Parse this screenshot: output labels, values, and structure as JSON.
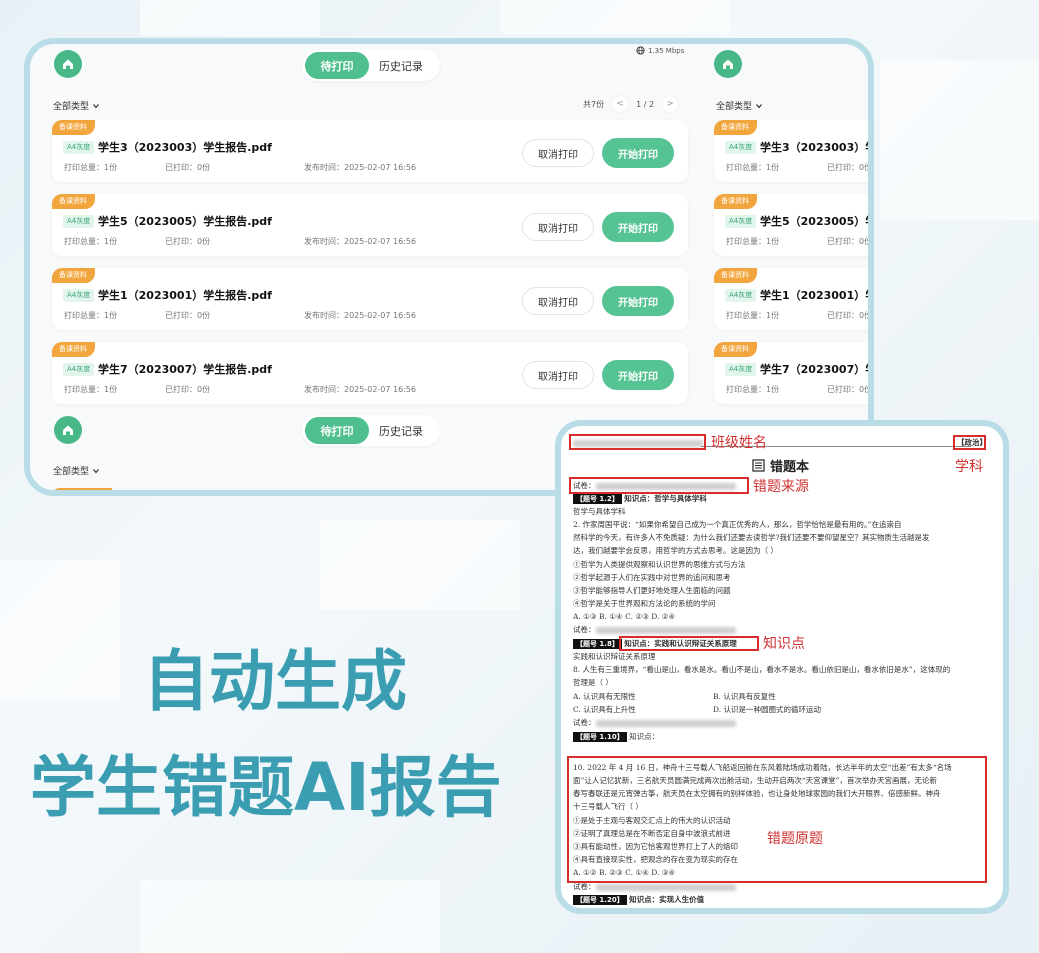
{
  "app": {
    "tabs": [
      {
        "label": "待打印",
        "active": true
      },
      {
        "label": "历史记录",
        "active": false
      }
    ],
    "network_speed": "1.35 Mbps",
    "filter_label": "全部类型",
    "pager": {
      "total": "共7份",
      "page": "1 / 2",
      "prev": "<",
      "next": ">"
    },
    "cards": [
      {
        "tag": "备课资料",
        "paper": "A4灰度",
        "file": "学生3（2023003）学生报告.pdf",
        "total": "打印总量：1份",
        "printed": "已打印：0份",
        "time": "发布时间：2025-02-07 16:56",
        "cancel": "取消打印",
        "start": "开始打印"
      },
      {
        "tag": "备课资料",
        "paper": "A4灰度",
        "file": "学生5（2023005）学生报告.pdf",
        "total": "打印总量：1份",
        "printed": "已打印：0份",
        "time": "发布时间：2025-02-07 16:56",
        "cancel": "取消打印",
        "start": "开始打印"
      },
      {
        "tag": "备课资料",
        "paper": "A4灰度",
        "file": "学生1（2023001）学生报告.pdf",
        "total": "打印总量：1份",
        "printed": "已打印：0份",
        "time": "发布时间：2025-02-07 16:56",
        "cancel": "取消打印",
        "start": "开始打印"
      },
      {
        "tag": "备课资料",
        "paper": "A4灰度",
        "file": "学生7（2023007）学生报告.pdf",
        "total": "打印总量：1份",
        "printed": "已打印：0份",
        "time": "发布时间：2025-02-07 16:56",
        "cancel": "取消打印",
        "start": "开始打印"
      }
    ]
  },
  "headline": {
    "line1": "自动生成",
    "line2": "学生错题AI报告"
  },
  "doc": {
    "subject_tag": "【政治】",
    "title": "错题本",
    "title_icon": "list-icon",
    "paper_prefix": "试卷：",
    "q1_tag": "【题号 1.2】",
    "q1_kp": "知识点：哲学与具体学科",
    "q1_kp_line": "哲学与具体学科",
    "q1_text": [
      "2.   作家周国平说：“如果你希望自己成为一个真正优秀的人，那么，哲学恰恰是最有用的。”在追崇自",
      "然科学的今天，有许多人不免质疑：为什么我们还要去读哲学?我们还要不要仰望星空？其实物质生活越是发",
      "达，我们越要学会反思，用哲学的方式去思考。这是因为（  ）",
      "①哲学为人类提供观察和认识世界的思维方式与方法",
      "②哲学起源于人们在实践中对世界的追问和思考",
      "③哲学能够指导人们更好地处理人生面临的问题",
      "④哲学是关于世界观和方法论的系统的学问",
      "A. ①③  B. ①④  C. ②③  D. ②④"
    ],
    "q2_tag": "【题号 1.8】",
    "q2_kp": "知识点：实践和认识辩证关系原理",
    "q2_kp_line": "实践和认识辩证关系原理",
    "q2_text": [
      "8. 人生有三重境界，“看山是山，看水是水。看山不是山，看水不是水。看山依旧是山，看水依旧是水”，这体现的",
      "哲理是（  ）"
    ],
    "q2_opts": [
      [
        "A.   认识具有无限性",
        "B.   认识具有反复性"
      ],
      [
        "C.   认识具有上升性",
        "D.   认识是一种圆圈式的循环运动"
      ]
    ],
    "q3_tag": "【题号 1.10】",
    "q3_kp": "知识点：",
    "q3_text": [
      "10. 2022 年 4 月 16 日，神舟十三号载人飞船返回舱在东风着陆场成功着陆，长达半年的太空“出差”有太多“名场",
      "面”让人记忆犹新，三名航天员圆满完成两次出舱活动，生动开启两次“天宫课堂”，首次举办天宫画展，无论新",
      "春写春联还是元宵弹古筝，航天员在太空拥有的别样体验，也让身处地球家园的我们大开眼界、倍感新鲜。神舟",
      "十三号载人飞行（  ）",
      "①是处于主观与客观交汇点上的伟大的认识活动",
      "②证明了真理总是在不断否定自身中波浪式前进",
      "③具有能动性，因为它恰客观世界打上了人的烙印",
      "④具有直接现实性，把观念的存在变为现实的存在",
      "A. ①②  B. ②③  C. ①④  D. ③④"
    ],
    "q4_tag": "【题号 1.20】",
    "q4_kp": "知识点：实现人生价值",
    "annotations": {
      "class_name": "班级姓名",
      "subject": "学科",
      "source": "错题来源",
      "knowledge": "知识点",
      "original": "错题原题"
    }
  },
  "colors": {
    "accent": "#4fbf8f",
    "tag": "#f2a53c",
    "headline": "#3a9db1",
    "frame": "#b9dde7",
    "annotation": "#d62d2d"
  }
}
